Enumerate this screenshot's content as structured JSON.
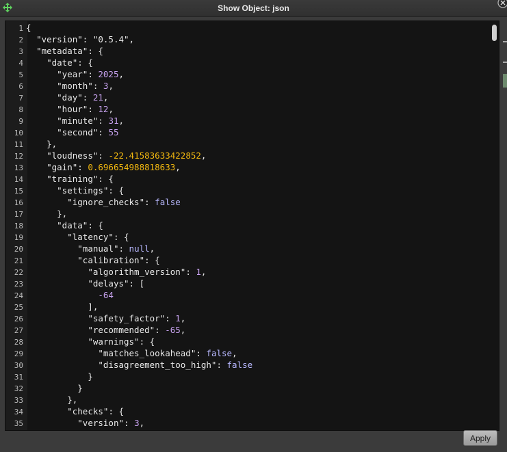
{
  "window": {
    "title": "Show Object: json"
  },
  "footer": {
    "apply_label": "Apply"
  },
  "editor": {
    "lines": [
      {
        "n": "1",
        "t": [
          [
            "p",
            "{"
          ]
        ]
      },
      {
        "n": "2",
        "t": [
          [
            "p",
            "  "
          ],
          [
            "s",
            "\"version\""
          ],
          [
            "p",
            ": "
          ],
          [
            "s",
            "\"0.5.4\""
          ],
          [
            "p",
            ","
          ]
        ]
      },
      {
        "n": "3",
        "t": [
          [
            "p",
            "  "
          ],
          [
            "s",
            "\"metadata\""
          ],
          [
            "p",
            ": {"
          ]
        ]
      },
      {
        "n": "4",
        "t": [
          [
            "p",
            "    "
          ],
          [
            "s",
            "\"date\""
          ],
          [
            "p",
            ": {"
          ]
        ]
      },
      {
        "n": "5",
        "t": [
          [
            "p",
            "      "
          ],
          [
            "s",
            "\"year\""
          ],
          [
            "p",
            ": "
          ],
          [
            "n",
            "2025"
          ],
          [
            "p",
            ","
          ]
        ]
      },
      {
        "n": "6",
        "t": [
          [
            "p",
            "      "
          ],
          [
            "s",
            "\"month\""
          ],
          [
            "p",
            ": "
          ],
          [
            "n",
            "3"
          ],
          [
            "p",
            ","
          ]
        ]
      },
      {
        "n": "7",
        "t": [
          [
            "p",
            "      "
          ],
          [
            "s",
            "\"day\""
          ],
          [
            "p",
            ": "
          ],
          [
            "n",
            "21"
          ],
          [
            "p",
            ","
          ]
        ]
      },
      {
        "n": "8",
        "t": [
          [
            "p",
            "      "
          ],
          [
            "s",
            "\"hour\""
          ],
          [
            "p",
            ": "
          ],
          [
            "n",
            "12"
          ],
          [
            "p",
            ","
          ]
        ]
      },
      {
        "n": "9",
        "t": [
          [
            "p",
            "      "
          ],
          [
            "s",
            "\"minute\""
          ],
          [
            "p",
            ": "
          ],
          [
            "n",
            "31"
          ],
          [
            "p",
            ","
          ]
        ]
      },
      {
        "n": "10",
        "t": [
          [
            "p",
            "      "
          ],
          [
            "s",
            "\"second\""
          ],
          [
            "p",
            ": "
          ],
          [
            "n",
            "55"
          ]
        ]
      },
      {
        "n": "11",
        "t": [
          [
            "p",
            "    },"
          ]
        ]
      },
      {
        "n": "12",
        "t": [
          [
            "p",
            "    "
          ],
          [
            "s",
            "\"loudness\""
          ],
          [
            "p",
            ": "
          ],
          [
            "f",
            "-22.41583633422852"
          ],
          [
            "p",
            ","
          ]
        ]
      },
      {
        "n": "13",
        "t": [
          [
            "p",
            "    "
          ],
          [
            "s",
            "\"gain\""
          ],
          [
            "p",
            ": "
          ],
          [
            "f",
            "0.696654988818633"
          ],
          [
            "p",
            ","
          ]
        ]
      },
      {
        "n": "14",
        "t": [
          [
            "p",
            "    "
          ],
          [
            "s",
            "\"training\""
          ],
          [
            "p",
            ": {"
          ]
        ]
      },
      {
        "n": "15",
        "t": [
          [
            "p",
            "      "
          ],
          [
            "s",
            "\"settings\""
          ],
          [
            "p",
            ": {"
          ]
        ]
      },
      {
        "n": "16",
        "t": [
          [
            "p",
            "        "
          ],
          [
            "s",
            "\"ignore_checks\""
          ],
          [
            "p",
            ": "
          ],
          [
            "b",
            "false"
          ]
        ]
      },
      {
        "n": "17",
        "t": [
          [
            "p",
            "      },"
          ]
        ]
      },
      {
        "n": "18",
        "t": [
          [
            "p",
            "      "
          ],
          [
            "s",
            "\"data\""
          ],
          [
            "p",
            ": {"
          ]
        ]
      },
      {
        "n": "19",
        "t": [
          [
            "p",
            "        "
          ],
          [
            "s",
            "\"latency\""
          ],
          [
            "p",
            ": {"
          ]
        ]
      },
      {
        "n": "20",
        "t": [
          [
            "p",
            "          "
          ],
          [
            "s",
            "\"manual\""
          ],
          [
            "p",
            ": "
          ],
          [
            "b",
            "null"
          ],
          [
            "p",
            ","
          ]
        ]
      },
      {
        "n": "21",
        "t": [
          [
            "p",
            "          "
          ],
          [
            "s",
            "\"calibration\""
          ],
          [
            "p",
            ": {"
          ]
        ]
      },
      {
        "n": "22",
        "t": [
          [
            "p",
            "            "
          ],
          [
            "s",
            "\"algorithm_version\""
          ],
          [
            "p",
            ": "
          ],
          [
            "n",
            "1"
          ],
          [
            "p",
            ","
          ]
        ]
      },
      {
        "n": "23",
        "t": [
          [
            "p",
            "            "
          ],
          [
            "s",
            "\"delays\""
          ],
          [
            "p",
            ": ["
          ]
        ]
      },
      {
        "n": "24",
        "t": [
          [
            "p",
            "              "
          ],
          [
            "n",
            "-64"
          ]
        ]
      },
      {
        "n": "25",
        "t": [
          [
            "p",
            "            ],"
          ]
        ]
      },
      {
        "n": "26",
        "t": [
          [
            "p",
            "            "
          ],
          [
            "s",
            "\"safety_factor\""
          ],
          [
            "p",
            ": "
          ],
          [
            "n",
            "1"
          ],
          [
            "p",
            ","
          ]
        ]
      },
      {
        "n": "27",
        "t": [
          [
            "p",
            "            "
          ],
          [
            "s",
            "\"recommended\""
          ],
          [
            "p",
            ": "
          ],
          [
            "n",
            "-65"
          ],
          [
            "p",
            ","
          ]
        ]
      },
      {
        "n": "28",
        "t": [
          [
            "p",
            "            "
          ],
          [
            "s",
            "\"warnings\""
          ],
          [
            "p",
            ": {"
          ]
        ]
      },
      {
        "n": "29",
        "t": [
          [
            "p",
            "              "
          ],
          [
            "s",
            "\"matches_lookahead\""
          ],
          [
            "p",
            ": "
          ],
          [
            "b",
            "false"
          ],
          [
            "p",
            ","
          ]
        ]
      },
      {
        "n": "30",
        "t": [
          [
            "p",
            "              "
          ],
          [
            "s",
            "\"disagreement_too_high\""
          ],
          [
            "p",
            ": "
          ],
          [
            "b",
            "false"
          ]
        ]
      },
      {
        "n": "31",
        "t": [
          [
            "p",
            "            }"
          ]
        ]
      },
      {
        "n": "32",
        "t": [
          [
            "p",
            "          }"
          ]
        ]
      },
      {
        "n": "33",
        "t": [
          [
            "p",
            "        },"
          ]
        ]
      },
      {
        "n": "34",
        "t": [
          [
            "p",
            "        "
          ],
          [
            "s",
            "\"checks\""
          ],
          [
            "p",
            ": {"
          ]
        ]
      },
      {
        "n": "35",
        "t": [
          [
            "p",
            "          "
          ],
          [
            "s",
            "\"version\""
          ],
          [
            "p",
            ": "
          ],
          [
            "n",
            "3"
          ],
          [
            "p",
            ","
          ]
        ]
      }
    ]
  },
  "colors": {
    "number": "#c8a3f0",
    "float": "#f2b80f",
    "literal": "#b8b8ff",
    "text": "#f0f0f0"
  },
  "icons": {
    "move": "move-arrows-icon",
    "close": "close-icon"
  }
}
